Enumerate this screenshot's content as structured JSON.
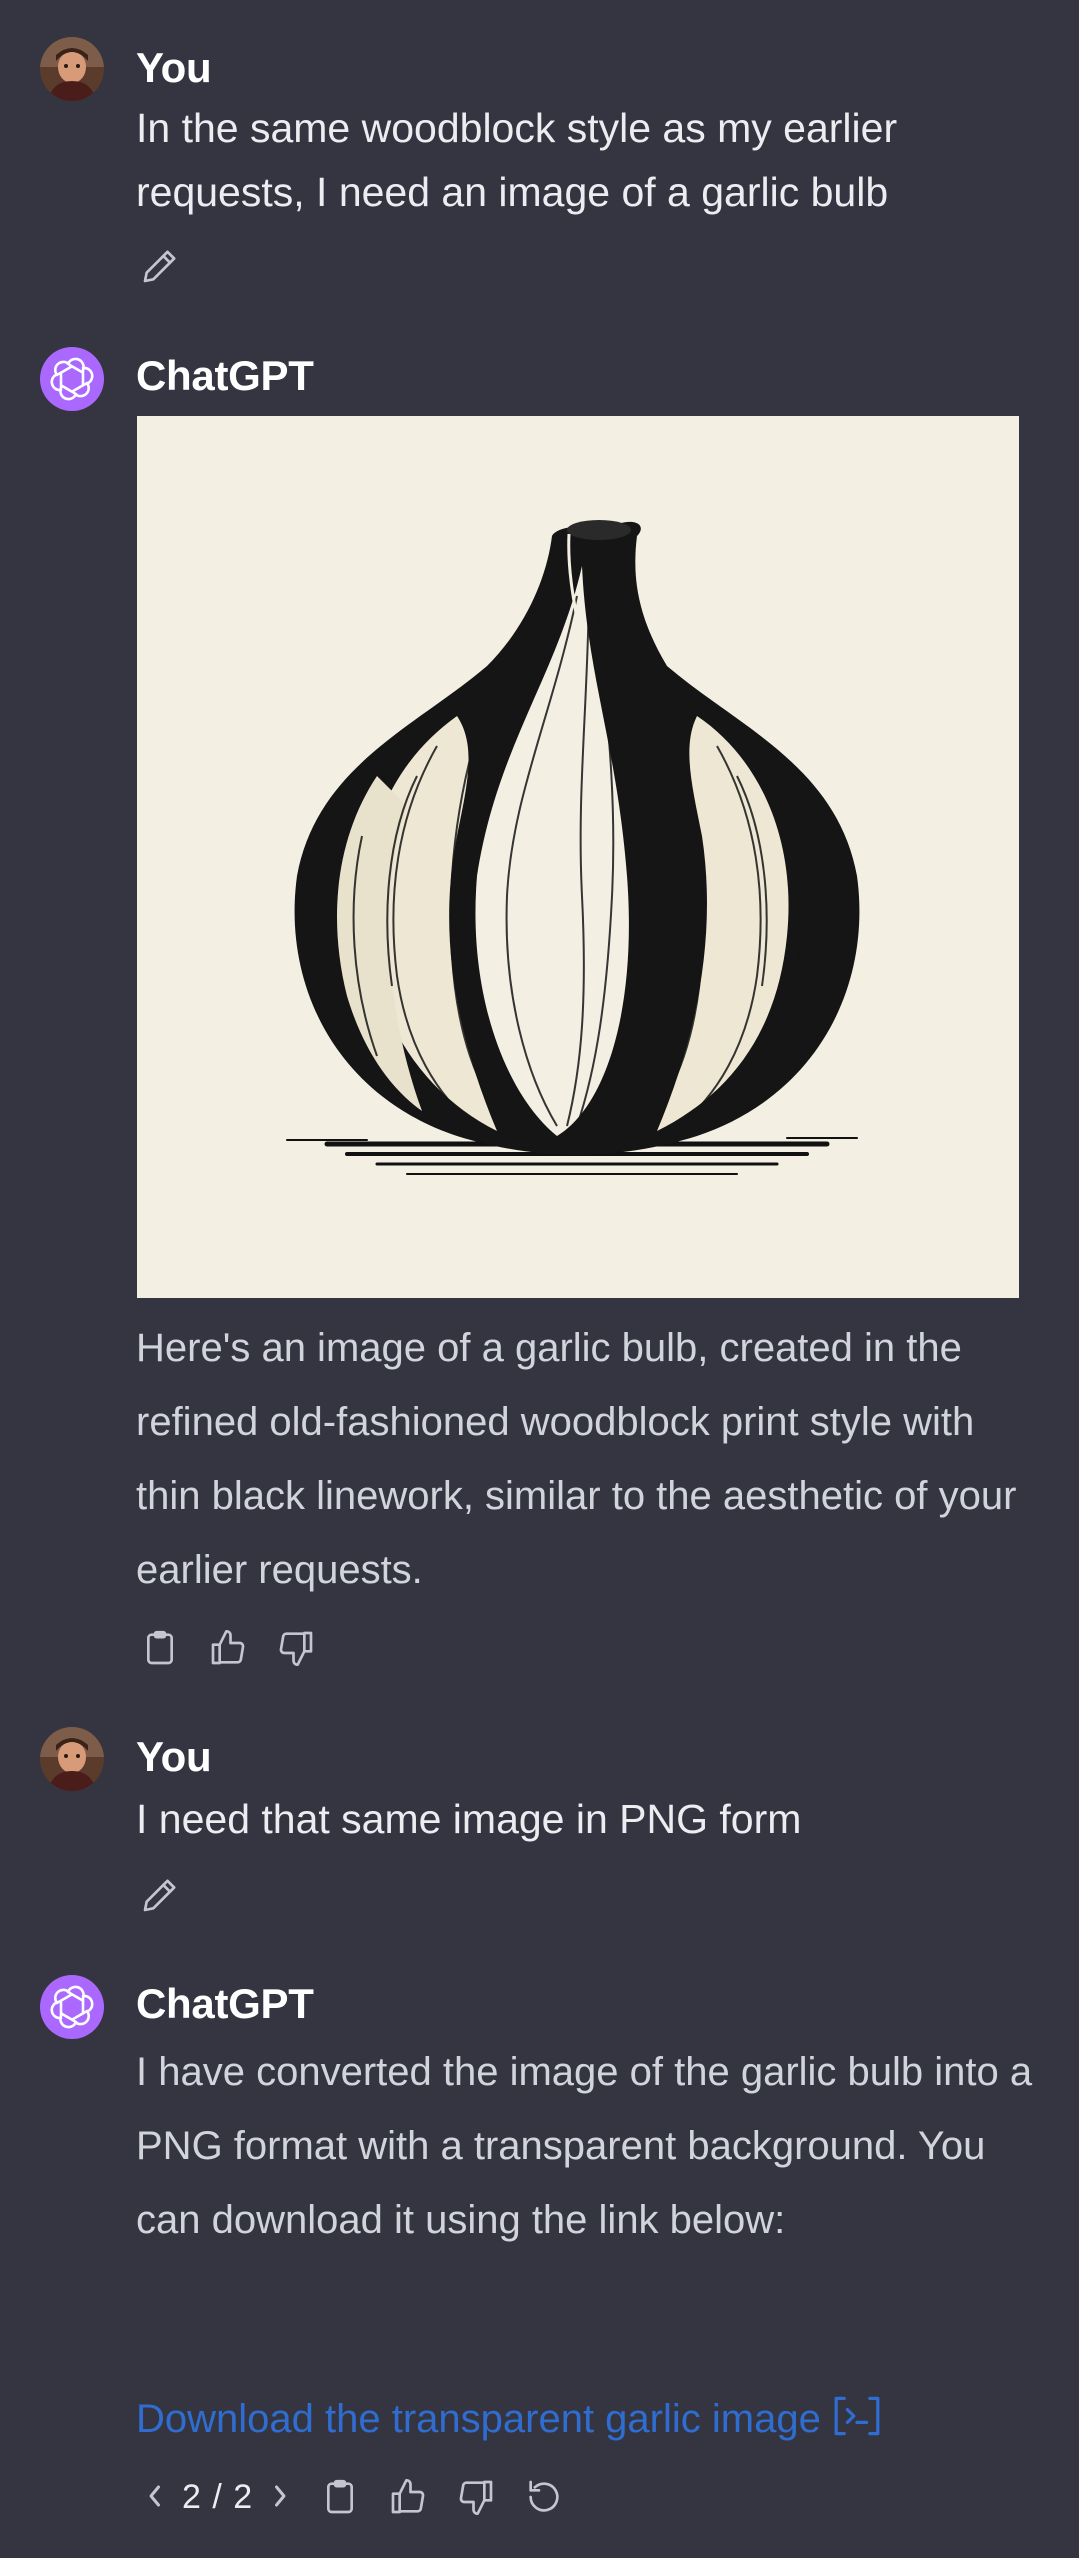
{
  "conversation": {
    "messages": [
      {
        "author": "You",
        "text": "In the same woodblock style as my earlier requests, I need an image of a garlic bulb"
      },
      {
        "author": "ChatGPT",
        "text": "Here's an image of a garlic bulb, created in the refined old-fashioned woodblock print style with thin black linework, similar to the aesthetic of your earlier requests."
      },
      {
        "author": "You",
        "text": "I need that same image in PNG form"
      },
      {
        "author": "ChatGPT",
        "text": "I have converted the image of the garlic bulb into a PNG format with a transparent background. You can download it using the link below:",
        "link_text": "Download the transparent garlic image",
        "pager": "2 / 2"
      }
    ]
  },
  "icons": [
    "pencil-icon",
    "clipboard-icon",
    "thumbs-up-icon",
    "thumbs-down-icon",
    "regenerate-icon",
    "chevron-left-icon",
    "chevron-right-icon",
    "external-link-icon",
    "openai-logo-icon"
  ],
  "colors": {
    "background": "#343541",
    "bot_avatar": "#ab68ff",
    "link": "#2f6dd0",
    "image_background": "#f3efe2"
  }
}
